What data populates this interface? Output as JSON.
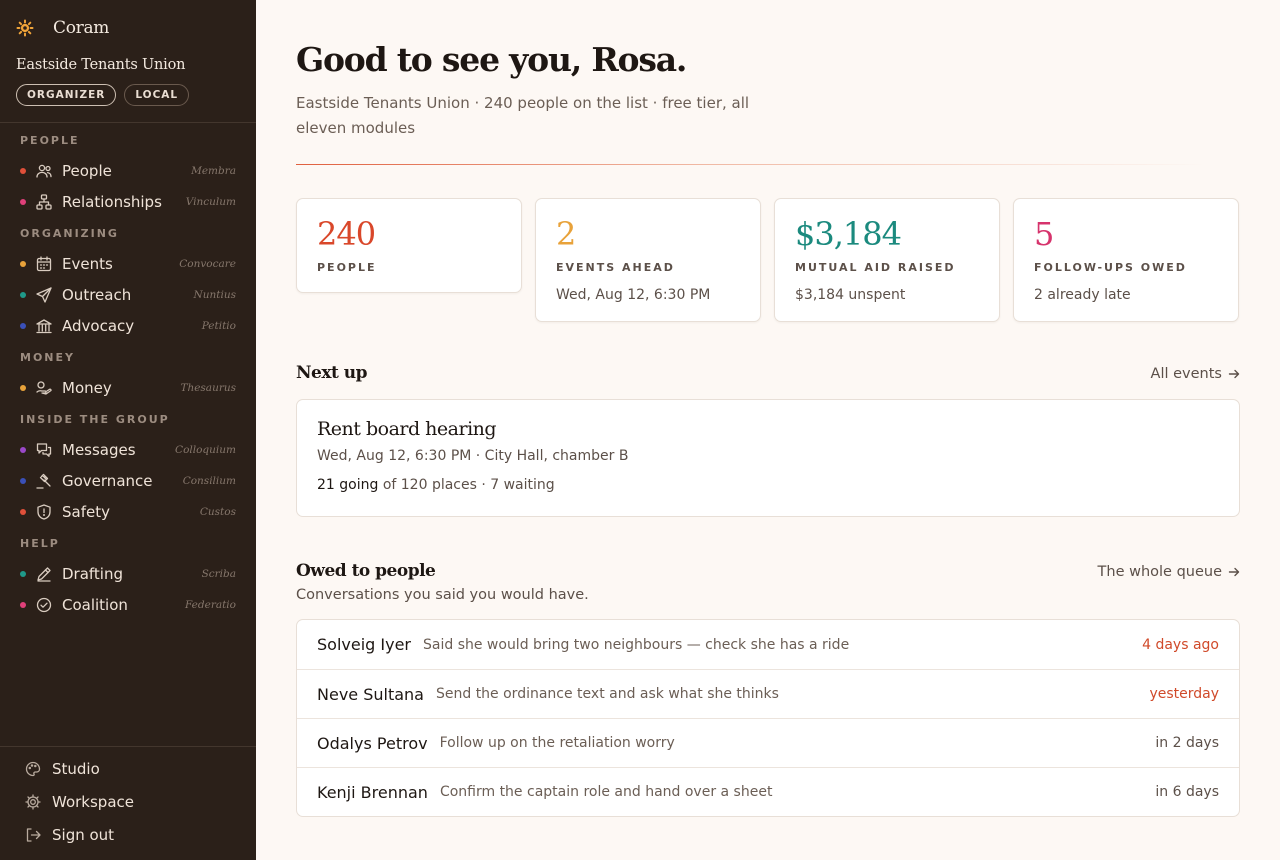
{
  "app": {
    "name": "Coram"
  },
  "sidebar": {
    "org_name": "Eastside Tenants Union",
    "chips": [
      "ORGANIZER",
      "LOCAL"
    ],
    "sections": [
      {
        "title": "PEOPLE",
        "items": [
          {
            "label": "People",
            "latin": "Membra",
            "icon": "people-icon",
            "dot": "#e0503a"
          },
          {
            "label": "Relationships",
            "latin": "Vinculum",
            "icon": "network-icon",
            "dot": "#e0407a"
          }
        ]
      },
      {
        "title": "ORGANIZING",
        "items": [
          {
            "label": "Events",
            "latin": "Convocare",
            "icon": "calendar-icon",
            "dot": "#e8a23a"
          },
          {
            "label": "Outreach",
            "latin": "Nuntius",
            "icon": "send-icon",
            "dot": "#1f9a8a"
          },
          {
            "label": "Advocacy",
            "latin": "Petitio",
            "icon": "building-icon",
            "dot": "#3a50b8"
          }
        ]
      },
      {
        "title": "MONEY",
        "items": [
          {
            "label": "Money",
            "latin": "Thesaurus",
            "icon": "money-icon",
            "dot": "#e8a23a"
          }
        ]
      },
      {
        "title": "INSIDE THE GROUP",
        "items": [
          {
            "label": "Messages",
            "latin": "Colloquium",
            "icon": "messages-icon",
            "dot": "#9a48c8"
          },
          {
            "label": "Governance",
            "latin": "Consilium",
            "icon": "gavel-icon",
            "dot": "#3a50b8"
          },
          {
            "label": "Safety",
            "latin": "Custos",
            "icon": "shield-icon",
            "dot": "#e0503a"
          }
        ]
      },
      {
        "title": "HELP",
        "items": [
          {
            "label": "Drafting",
            "latin": "Scriba",
            "icon": "pen-icon",
            "dot": "#1f9a8a"
          },
          {
            "label": "Coalition",
            "latin": "Federatio",
            "icon": "check-badge-icon",
            "dot": "#e0407a"
          }
        ]
      }
    ],
    "footer": [
      {
        "label": "Studio",
        "icon": "palette-icon"
      },
      {
        "label": "Workspace",
        "icon": "gear-icon"
      },
      {
        "label": "Sign out",
        "icon": "sign-out-icon"
      }
    ]
  },
  "main": {
    "greeting": "Good to see you, Rosa.",
    "subtitle": "Eastside Tenants Union · 240 people on the list · free tier, all eleven modules",
    "stats": [
      {
        "value": "240",
        "label": "PEOPLE",
        "sub": "",
        "color": "#d9472a"
      },
      {
        "value": "2",
        "label": "EVENTS AHEAD",
        "sub": "Wed, Aug 12, 6:30 PM",
        "color": "#e8a23a"
      },
      {
        "value": "$3,184",
        "label": "MUTUAL AID RAISED",
        "sub": "$3,184 unspent",
        "color": "#1b8a7e"
      },
      {
        "value": "5",
        "label": "FOLLOW-UPS OWED",
        "sub": "2 already late",
        "color": "#d6336c"
      }
    ],
    "next_up": {
      "title": "Next up",
      "link": "All events",
      "event": {
        "title": "Rent board hearing",
        "meta": "Wed, Aug 12, 6:30 PM · City Hall, chamber B",
        "going": "21 going",
        "capacity": " of 120 places · 7 waiting"
      }
    },
    "owed": {
      "title": "Owed to people",
      "link": "The whole queue",
      "subtitle": "Conversations you said you would have.",
      "rows": [
        {
          "name": "Solveig Iyer",
          "note": "Said she would bring two neighbours — check she has a ride",
          "when": "4 days ago",
          "late": true
        },
        {
          "name": "Neve Sultana",
          "note": "Send the ordinance text and ask what she thinks",
          "when": "yesterday",
          "late": true
        },
        {
          "name": "Odalys Petrov",
          "note": "Follow up on the retaliation worry",
          "when": "in 2 days",
          "late": false
        },
        {
          "name": "Kenji Brennan",
          "note": "Confirm the captain role and hand over a sheet",
          "when": "in 6 days",
          "late": false
        }
      ]
    }
  }
}
